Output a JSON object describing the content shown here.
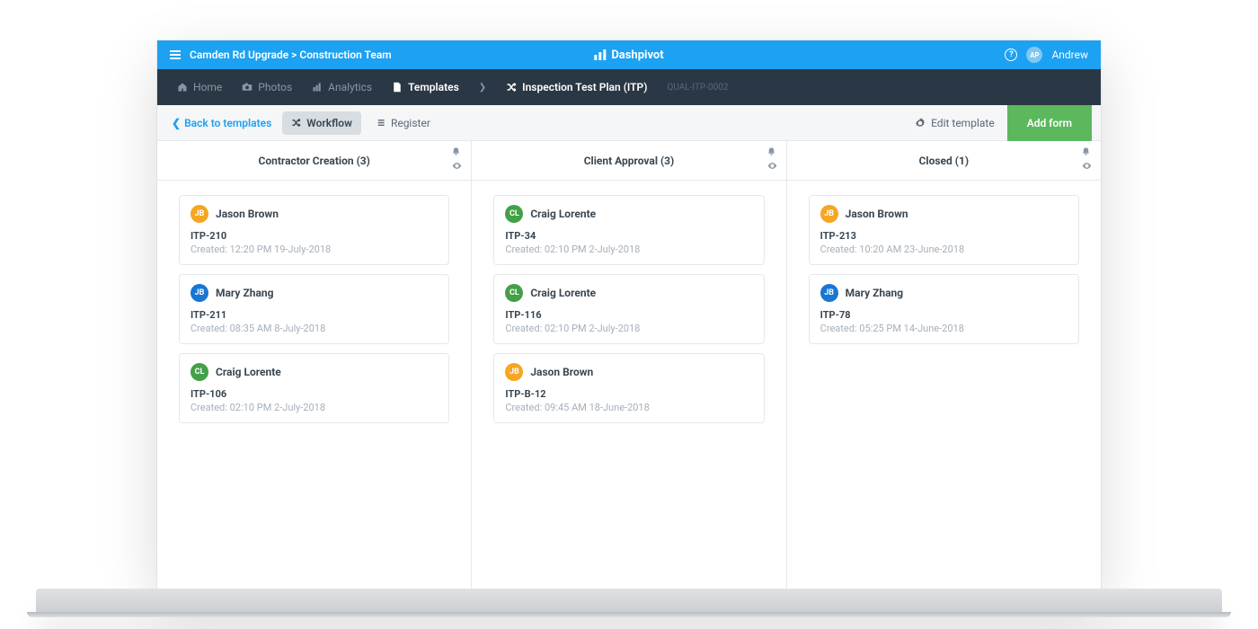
{
  "topbar": {
    "breadcrumb": "Camden Rd Upgrade > Construction Team",
    "app_name": "Dashpivot",
    "user_initials": "AP",
    "user_name": "Andrew"
  },
  "navbar": {
    "home": "Home",
    "photos": "Photos",
    "analytics": "Analytics",
    "templates": "Templates",
    "current_template": "Inspection Test Plan (ITP)",
    "template_id": "QUAL-ITP-0002"
  },
  "subbar": {
    "back": "Back to templates",
    "workflow": "Workflow",
    "register": "Register",
    "edit": "Edit template",
    "add_form": "Add form"
  },
  "columns": [
    {
      "title": "Contractor Creation (3)",
      "cards": [
        {
          "initials": "JB",
          "color": "orange",
          "name": "Jason Brown",
          "code": "ITP-210",
          "meta": "Created: 12:20 PM 19-July-2018"
        },
        {
          "initials": "JB",
          "color": "blue",
          "name": "Mary Zhang",
          "code": "ITP-211",
          "meta": "Created: 08:35 AM 8-July-2018"
        },
        {
          "initials": "CL",
          "color": "green",
          "name": "Craig Lorente",
          "code": "ITP-106",
          "meta": "Created: 02:10 PM 2-July-2018"
        }
      ]
    },
    {
      "title": "Client Approval (3)",
      "cards": [
        {
          "initials": "CL",
          "color": "green",
          "name": "Craig Lorente",
          "code": "ITP-34",
          "meta": "Created: 02:10 PM 2-July-2018"
        },
        {
          "initials": "CL",
          "color": "green",
          "name": "Craig Lorente",
          "code": "ITP-116",
          "meta": "Created: 02:10 PM 2-July-2018"
        },
        {
          "initials": "JB",
          "color": "orange",
          "name": "Jason Brown",
          "code": "ITP-B-12",
          "meta": "Created: 09:45 AM 18-June-2018"
        }
      ]
    },
    {
      "title": "Closed (1)",
      "cards": [
        {
          "initials": "JB",
          "color": "orange",
          "name": "Jason Brown",
          "code": "ITP-213",
          "meta": "Created: 10:20 AM 23-June-2018"
        },
        {
          "initials": "JB",
          "color": "blue",
          "name": "Mary Zhang",
          "code": "ITP-78",
          "meta": "Created: 05:25 PM 14-June-2018"
        }
      ]
    }
  ]
}
